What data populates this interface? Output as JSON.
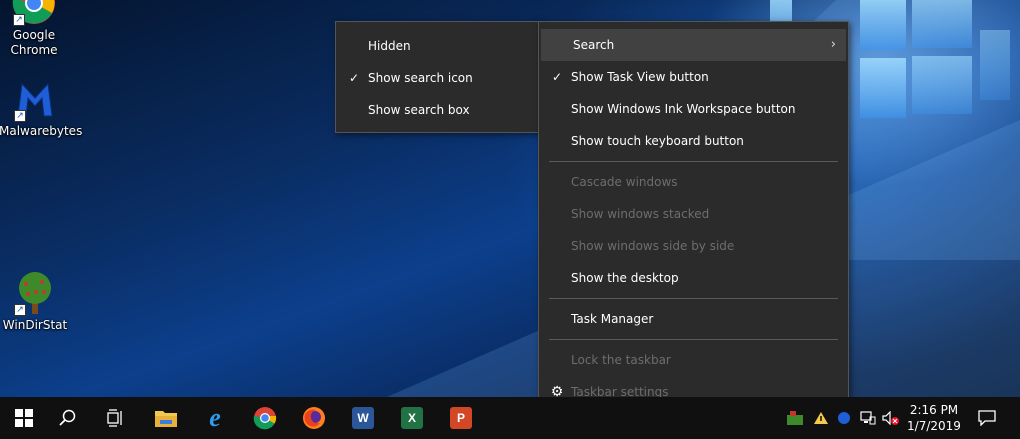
{
  "desktop_icons": [
    {
      "label": "Google\nChrome",
      "name": "chrome"
    },
    {
      "label": "Malwarebytes",
      "name": "malwarebytes"
    },
    {
      "label": "WinDirStat",
      "name": "windirstat"
    }
  ],
  "desktop_icon_labels": {
    "chrome_line1": "Google",
    "chrome_line2": "Chrome",
    "malwarebytes": "Malwarebytes",
    "windirstat": "WinDirStat"
  },
  "search_submenu": {
    "items": [
      {
        "label": "Hidden",
        "checked": false
      },
      {
        "label": "Show search icon",
        "checked": true
      },
      {
        "label": "Show search box",
        "checked": false
      }
    ]
  },
  "context_menu": {
    "search": "Search",
    "task_view": "Show Task View button",
    "ink_workspace": "Show Windows Ink Workspace button",
    "touch_keyboard": "Show touch keyboard button",
    "cascade": "Cascade windows",
    "stacked": "Show windows stacked",
    "side_by_side": "Show windows side by side",
    "show_desktop": "Show the desktop",
    "task_manager": "Task Manager",
    "lock_taskbar": "Lock the taskbar",
    "taskbar_settings": "Taskbar settings"
  },
  "glyphs": {
    "check": "✓",
    "arrow": "›",
    "gear": "⚙",
    "chevron_up": "˄"
  },
  "taskbar": {
    "apps": [
      "start-icon",
      "search-icon",
      "task-view-icon",
      "file-explorer-icon",
      "internet-explorer-icon",
      "chrome-icon",
      "firefox-icon",
      "word-icon",
      "excel-icon",
      "powerpoint-icon"
    ],
    "word_letter": "W",
    "excel_letter": "X",
    "ppt_letter": "P",
    "ie_letter": "e"
  },
  "clock": {
    "time": "2:16 PM",
    "date": "1/7/2019"
  },
  "colors": {
    "menu_bg": "#2b2b2b",
    "taskbar_bg": "#101010",
    "disabled_text": "#6d6d6d"
  }
}
